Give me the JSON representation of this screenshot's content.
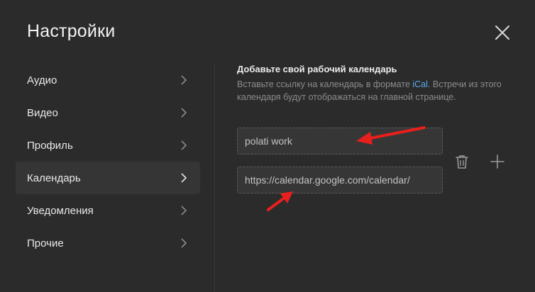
{
  "modal": {
    "title": "Настройки"
  },
  "sidebar": {
    "items": [
      {
        "label": "Аудио",
        "active": false
      },
      {
        "label": "Видео",
        "active": false
      },
      {
        "label": "Профиль",
        "active": false
      },
      {
        "label": "Календарь",
        "active": true
      },
      {
        "label": "Уведомления",
        "active": false
      },
      {
        "label": "Прочие",
        "active": false
      }
    ]
  },
  "calendar": {
    "heading": "Добавьте свой рабочий календарь",
    "desc_before": "Вставьте ссылку на календарь в формате ",
    "desc_link": "iCal",
    "desc_after": ". Встречи из этого календаря будут отображаться на главной странице.",
    "name_value": "polati work",
    "url_value": "https://calendar.google.com/calendar/"
  },
  "icons": {
    "close": "close-icon",
    "chevron": "chevron-right-icon",
    "trash": "trash-icon",
    "add": "plus-icon"
  },
  "colors": {
    "background": "#2b2b2b",
    "active_item": "#353535",
    "link": "#5aaaf0",
    "annotation_arrow": "#e8201c"
  }
}
